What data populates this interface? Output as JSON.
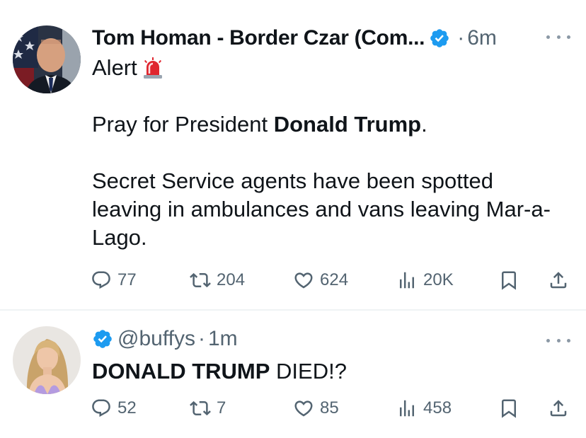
{
  "tweets": [
    {
      "author_name": "Tom Homan - Border Czar (Com...",
      "separator": "·",
      "time": "6m",
      "lines": [
        [
          {
            "text": "Alert",
            "bold": false
          }
        ],
        [],
        [
          {
            "text": "Pray for President ",
            "bold": false
          },
          {
            "text": "Donald Trump",
            "bold": true
          },
          {
            "text": ".",
            "bold": false
          }
        ],
        [],
        [
          {
            "text": "Secret Service agents have been spotted",
            "bold": false
          }
        ],
        [
          {
            "text": "leaving in ambulances and vans leaving Mar-a-",
            "bold": false
          }
        ],
        [
          {
            "text": "Lago.",
            "bold": false
          }
        ]
      ],
      "metrics": {
        "replies": "77",
        "retweets": "204",
        "likes": "624",
        "views": "20K"
      }
    },
    {
      "handle": "@buffys",
      "separator": "·",
      "time": "1m",
      "lines": [
        [
          {
            "text": "DONALD TRUMP",
            "bold": true
          },
          {
            "text": " DIED!?",
            "bold": false
          }
        ]
      ],
      "metrics": {
        "replies": "52",
        "retweets": "7",
        "likes": "85",
        "views": "458"
      }
    }
  ],
  "colors": {
    "verified": "#1d9bf0",
    "muted": "#536471",
    "text": "#0f1419",
    "divider": "#eff3f4"
  },
  "icons": [
    "reply-icon",
    "retweet-icon",
    "like-icon",
    "views-icon",
    "bookmark-icon",
    "share-icon",
    "verified-badge-icon",
    "siren-emoji-icon",
    "more-icon"
  ]
}
